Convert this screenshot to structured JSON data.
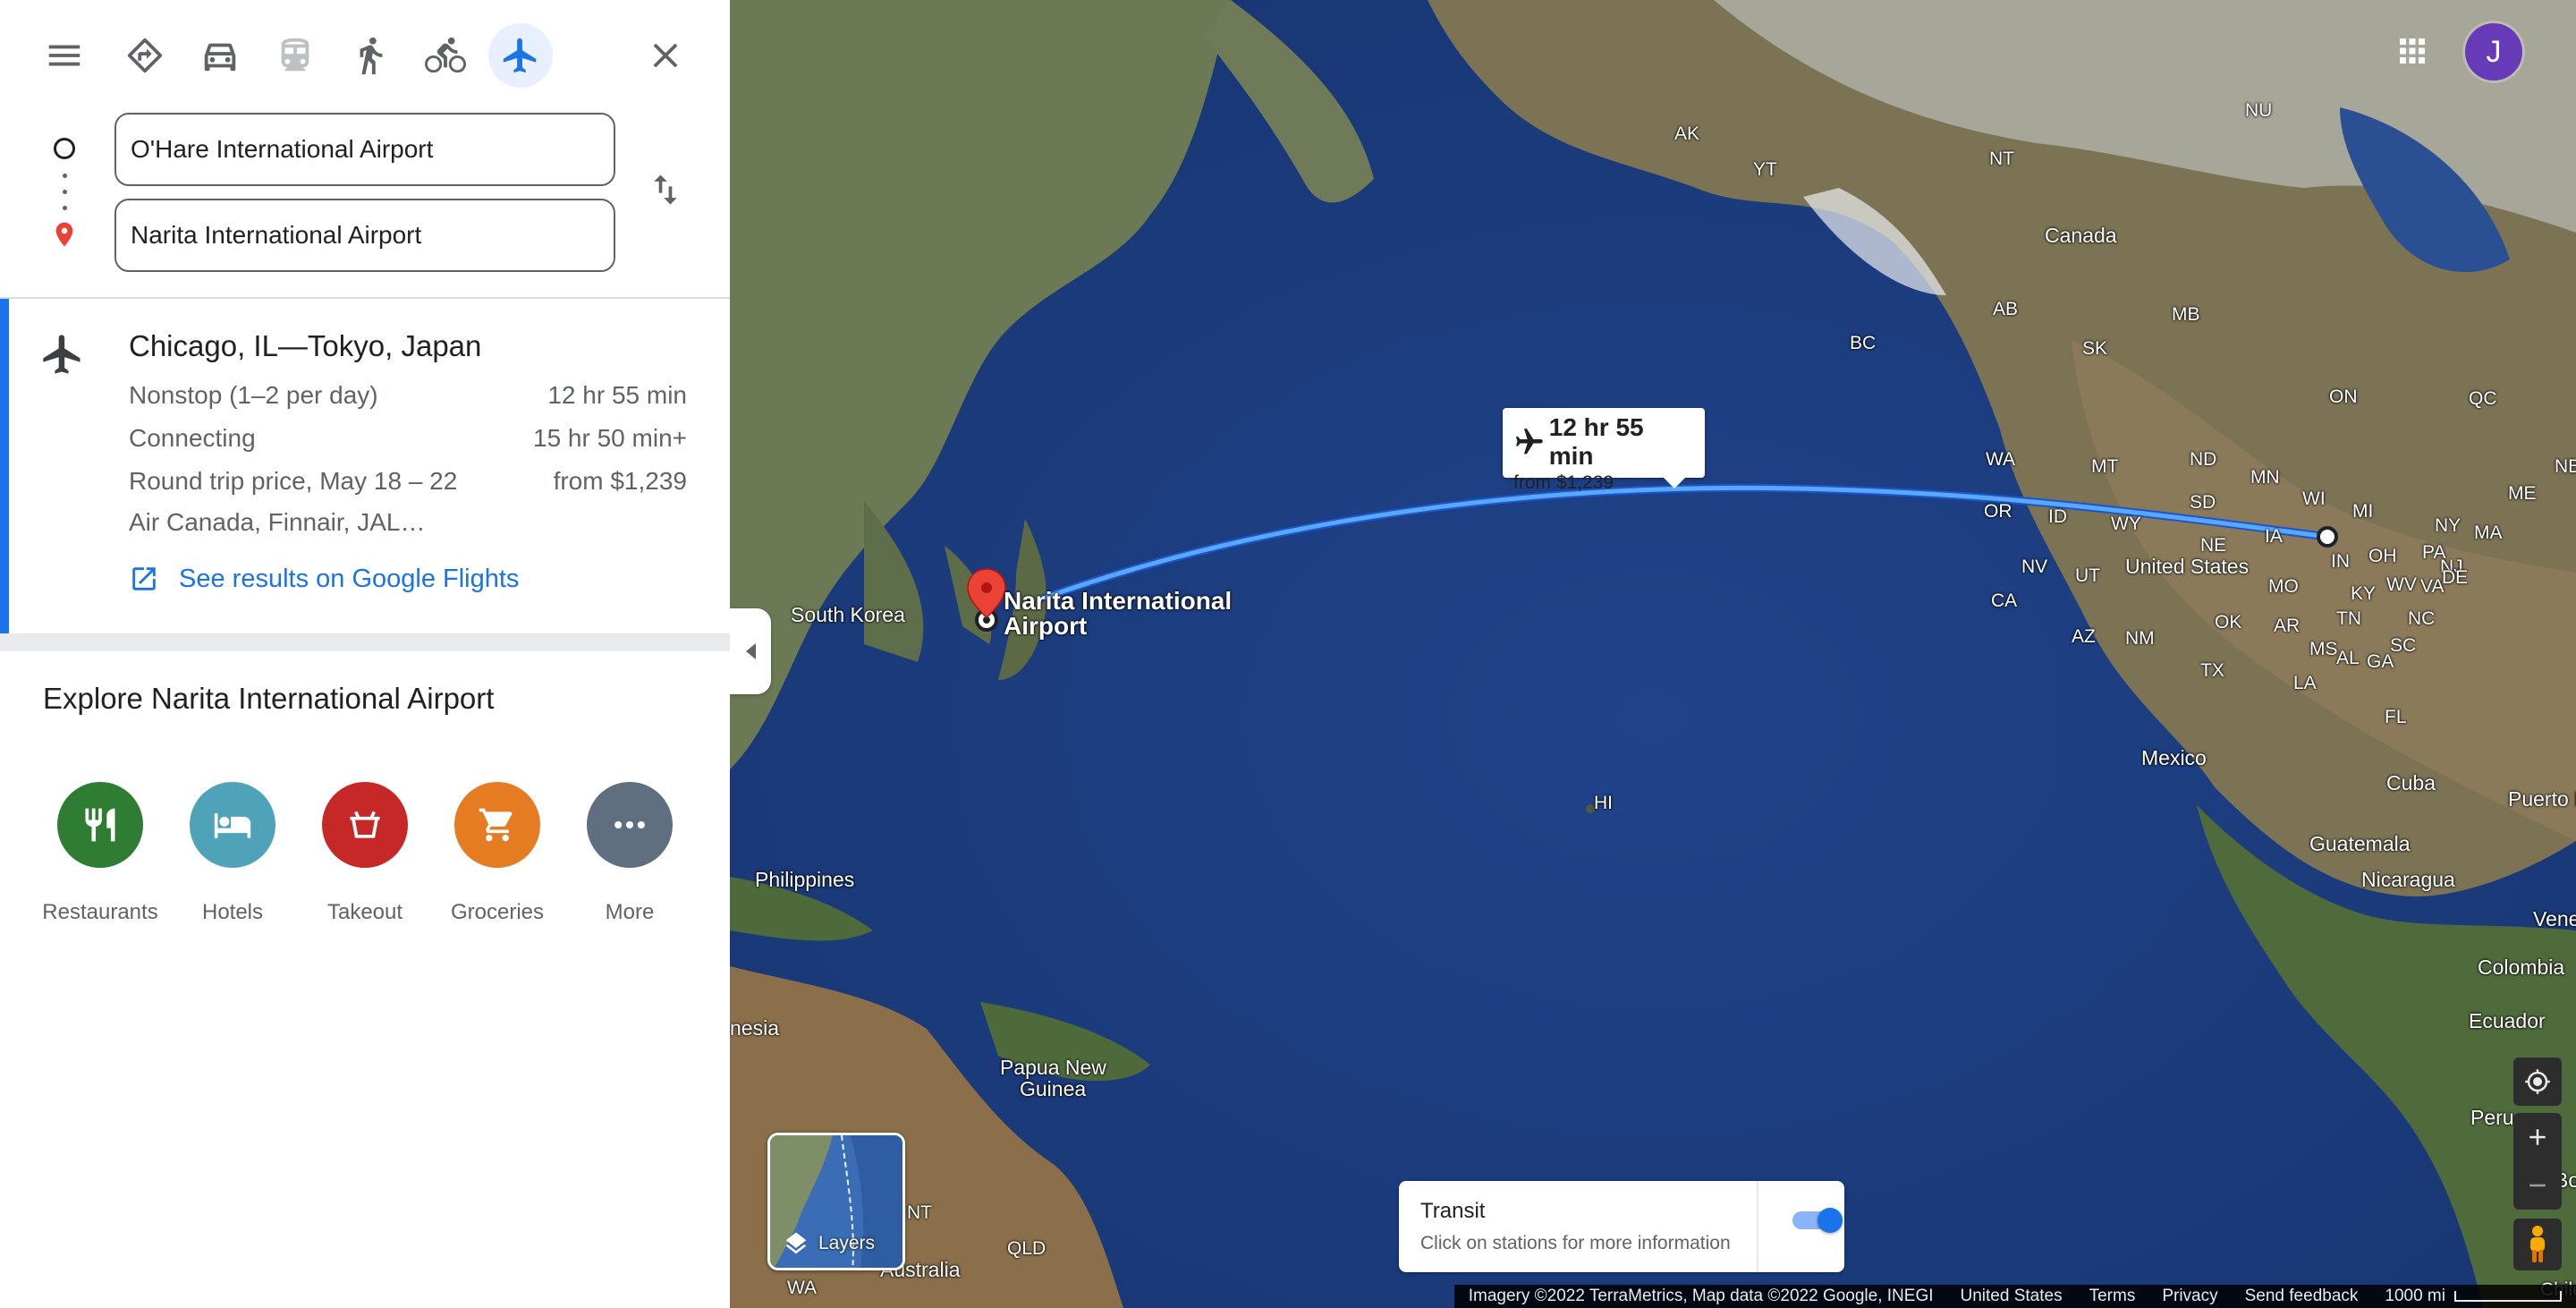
{
  "colors": {
    "accent": "#1a73e8",
    "restaurants": "#2e7d32",
    "hotels": "#4fa3b8",
    "takeout": "#c62828",
    "groceries": "#e67c22",
    "more": "#5f6f80",
    "pin": "#ea4335",
    "route": "#4c9bf7",
    "avatar": "#673ab7"
  },
  "topbar": {
    "icons": [
      "menu-icon",
      "directions-icon",
      "car-icon",
      "transit-icon",
      "walk-icon",
      "bike-icon",
      "flight-icon",
      "close-icon"
    ],
    "active_mode": "flight"
  },
  "directions": {
    "origin": "O'Hare International Airport",
    "destination": "Narita International Airport"
  },
  "route": {
    "title": "Chicago, IL—Tokyo, Japan",
    "rows": [
      {
        "label": "Nonstop (1–2 per day)",
        "value": "12 hr 55 min"
      },
      {
        "label": "Connecting",
        "value": "15 hr 50 min+"
      },
      {
        "label": "Round trip price, May 18 – 22",
        "value": "from $1,239"
      }
    ],
    "airlines": "Air Canada, Finnair, JAL…",
    "flights_link": "See results on Google Flights"
  },
  "explore": {
    "title": "Explore Narita International Airport",
    "categories": [
      {
        "label": "Restaurants",
        "icon": "restaurant-icon"
      },
      {
        "label": "Hotels",
        "icon": "hotel-icon"
      },
      {
        "label": "Takeout",
        "icon": "takeout-icon"
      },
      {
        "label": "Groceries",
        "icon": "groceries-icon"
      },
      {
        "label": "More",
        "icon": "more-icon"
      }
    ]
  },
  "map": {
    "callout_time": "12 hr 55 min",
    "callout_price": "from $1,239",
    "destination_label_1": "Narita International",
    "destination_label_2": "Airport",
    "avatar_letter": "J",
    "layers_label": "Layers",
    "transit_title": "Transit",
    "transit_sub": "Click on stations for more information",
    "transit_enabled": true,
    "labels": {
      "ak": "AK",
      "yt": "YT",
      "nt": "NT",
      "nu": "NU",
      "canada": "Canada",
      "bc": "BC",
      "ab": "AB",
      "sk": "SK",
      "mb": "MB",
      "on": "ON",
      "qc": "QC",
      "nb": "NB",
      "wa": "WA",
      "mt": "MT",
      "nd": "ND",
      "mn": "MN",
      "or": "OR",
      "id": "ID",
      "wy": "WY",
      "sd": "SD",
      "wi": "WI",
      "mi": "MI",
      "me": "ME",
      "ny": "NY",
      "ma": "MA",
      "ia": "IA",
      "ne": "NE",
      "nv": "NV",
      "ut": "UT",
      "in": "IN",
      "oh": "OH",
      "pa": "PA",
      "nj": "NJ",
      "de": "DE",
      "united_states": "United States",
      "mo": "MO",
      "ky": "KY",
      "wv": "WV",
      "va": "VA",
      "ca": "CA",
      "az": "AZ",
      "nm": "NM",
      "ok": "OK",
      "ar": "AR",
      "tn": "TN",
      "nc": "NC",
      "tx": "TX",
      "ms": "MS",
      "al": "AL",
      "ga": "GA",
      "sc": "SC",
      "la": "LA",
      "fl": "FL",
      "south_korea": "South Korea",
      "mexico": "Mexico",
      "cuba": "Cuba",
      "puerto_rico": "Puerto Ri",
      "hi": "HI",
      "philippines": "Philippines",
      "guatemala": "Guatemala",
      "nicaragua": "Nicaragua",
      "venezuela": "Venezue",
      "colombia": "Colombia",
      "ecuador": "Ecuador",
      "peru": "Peru",
      "bolivia": "Boliv",
      "chile": "Chile",
      "nesia": "nesia",
      "papua_1": "Papua New",
      "papua_2": "Guinea",
      "nt_au": "NT",
      "qld": "QLD",
      "australia": "Australia",
      "wa_au": "WA"
    },
    "footer": {
      "imagery": "Imagery ©2022 TerraMetrics, Map data ©2022 Google, INEGI",
      "country": "United States",
      "terms": "Terms",
      "privacy": "Privacy",
      "feedback": "Send feedback",
      "scale": "1000 mi"
    }
  }
}
